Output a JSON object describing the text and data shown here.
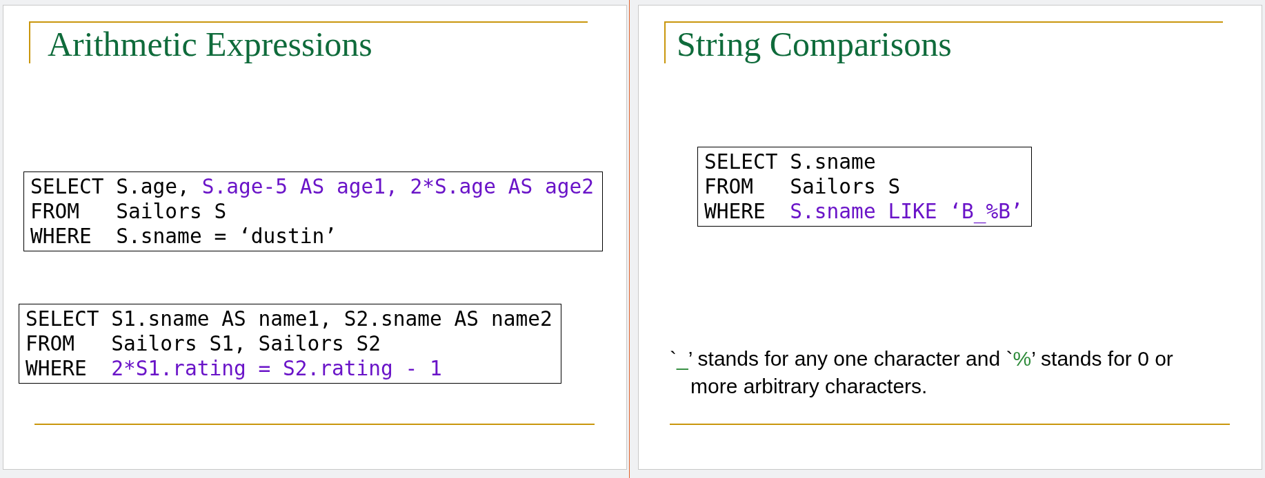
{
  "slides": [
    {
      "title": "Arithmetic Expressions",
      "code_blocks": [
        {
          "lines": [
            {
              "keyword": "SELECT",
              "parts": [
                {
                  "text": "S.age, ",
                  "highlight": false
                },
                {
                  "text": "S.age-5 AS age1, 2*S.age AS age2",
                  "highlight": true
                }
              ]
            },
            {
              "keyword": "FROM",
              "parts": [
                {
                  "text": "Sailors S",
                  "highlight": false
                }
              ]
            },
            {
              "keyword": "WHERE",
              "parts": [
                {
                  "text": "S.sname = ‘dustin’",
                  "highlight": false
                }
              ]
            }
          ]
        },
        {
          "lines": [
            {
              "keyword": "SELECT",
              "parts": [
                {
                  "text": "S1.sname AS name1, S2.sname AS name2",
                  "highlight": false
                }
              ]
            },
            {
              "keyword": "FROM",
              "parts": [
                {
                  "text": "Sailors S1, Sailors S2",
                  "highlight": false
                }
              ]
            },
            {
              "keyword": "WHERE",
              "parts": [
                {
                  "text": "2*S1.rating = S2.rating - 1",
                  "highlight": true
                }
              ]
            }
          ]
        }
      ]
    },
    {
      "title": "String Comparisons",
      "code_blocks": [
        {
          "lines": [
            {
              "keyword": "SELECT",
              "parts": [
                {
                  "text": "S.sname",
                  "highlight": false
                }
              ]
            },
            {
              "keyword": "FROM",
              "parts": [
                {
                  "text": "Sailors S",
                  "highlight": false
                }
              ]
            },
            {
              "keyword": "WHERE",
              "parts": [
                {
                  "text": "S.sname LIKE ‘B_%B’",
                  "highlight": true
                }
              ]
            }
          ]
        }
      ],
      "note": [
        {
          "text": "`",
          "highlight": false
        },
        {
          "text": "_",
          "highlight": true
        },
        {
          "text": "’ stands for any one character and `",
          "highlight": false
        },
        {
          "text": "%",
          "highlight": true
        },
        {
          "text": "’ stands for 0 or more arbitrary characters.",
          "highlight": false
        }
      ]
    }
  ]
}
